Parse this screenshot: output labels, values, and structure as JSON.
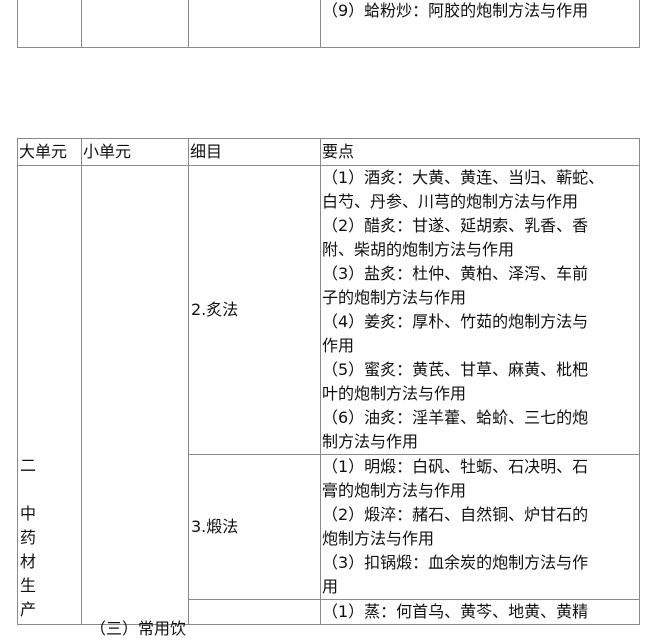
{
  "top_table": {
    "partial_row_points": "（9）蛤粉炒：阿胶的炮制方法与作用"
  },
  "main_table": {
    "headers": [
      "大单元",
      "小单元",
      "细目",
      "要点"
    ],
    "big_unit": {
      "number": "二",
      "chars": [
        "中",
        "药",
        "材",
        "生",
        "产"
      ]
    },
    "small_unit_label": "（三）常用饮",
    "rows": [
      {
        "detail": "2.炙法",
        "points": [
          "（1）酒炙：大黄、黄连、当归、蕲蛇、",
          "白芍、丹参、川芎的炮制方法与作用",
          "（2）醋炙：甘遂、延胡索、乳香、香",
          "附、柴胡的炮制方法与作用",
          "（3）盐炙：杜仲、黄柏、泽泻、车前",
          "子的炮制方法与作用",
          "（4）姜炙：厚朴、竹茹的炮制方法与",
          "作用",
          "（5）蜜炙：黄芪、甘草、麻黄、枇杷",
          "叶的炮制方法与作用",
          "（6）油炙：淫羊藿、蛤蚧、三七的炮",
          "制方法与作用"
        ]
      },
      {
        "detail": "3.煅法",
        "points": [
          "（1）明煅：白矾、牡蛎、石决明、石",
          "膏的炮制方法与作用",
          "（2）煅淬：赭石、自然铜、炉甘石的",
          "炮制方法与作用",
          "（3）扣锅煅：血余炭的炮制方法与作",
          "用"
        ]
      },
      {
        "detail": "",
        "points": [
          "（1）蒸：何首乌、黄芩、地黄、黄精"
        ]
      }
    ]
  }
}
